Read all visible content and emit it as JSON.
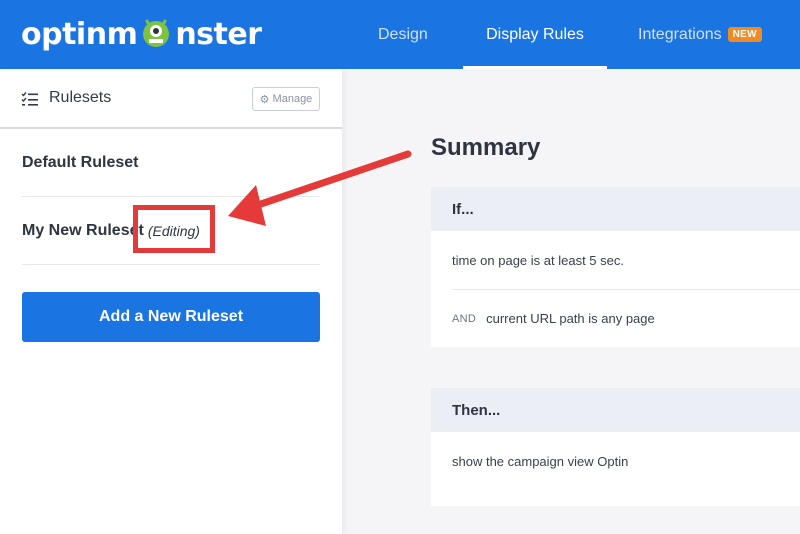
{
  "header": {
    "logo_text_left": "optinm",
    "logo_text_right": "nster",
    "tabs": [
      {
        "label": "Design",
        "active": false
      },
      {
        "label": "Display Rules",
        "active": true
      },
      {
        "label": "Integrations",
        "active": false,
        "badge": "NEW"
      }
    ]
  },
  "sidebar": {
    "title": "Rulesets",
    "manage_label": "Manage",
    "rulesets": [
      {
        "name": "Default Ruleset",
        "status": ""
      },
      {
        "name": "My New Ruleset",
        "status": "(Editing)"
      }
    ],
    "add_button_label": "Add a New Ruleset"
  },
  "summary": {
    "title": "Summary",
    "if_card": {
      "heading": "If...",
      "conditions": [
        {
          "connector": "",
          "text": "time on page is at least 5 sec."
        },
        {
          "connector": "AND",
          "text": "current URL path is any page"
        }
      ]
    },
    "then_card": {
      "heading": "Then...",
      "actions": [
        {
          "text": "show the campaign view Optin"
        }
      ]
    }
  },
  "colors": {
    "brand_blue": "#1a74e2",
    "new_badge": "#f08a24",
    "annotation_red": "#e53a3a",
    "monster_green": "#7dc242"
  }
}
